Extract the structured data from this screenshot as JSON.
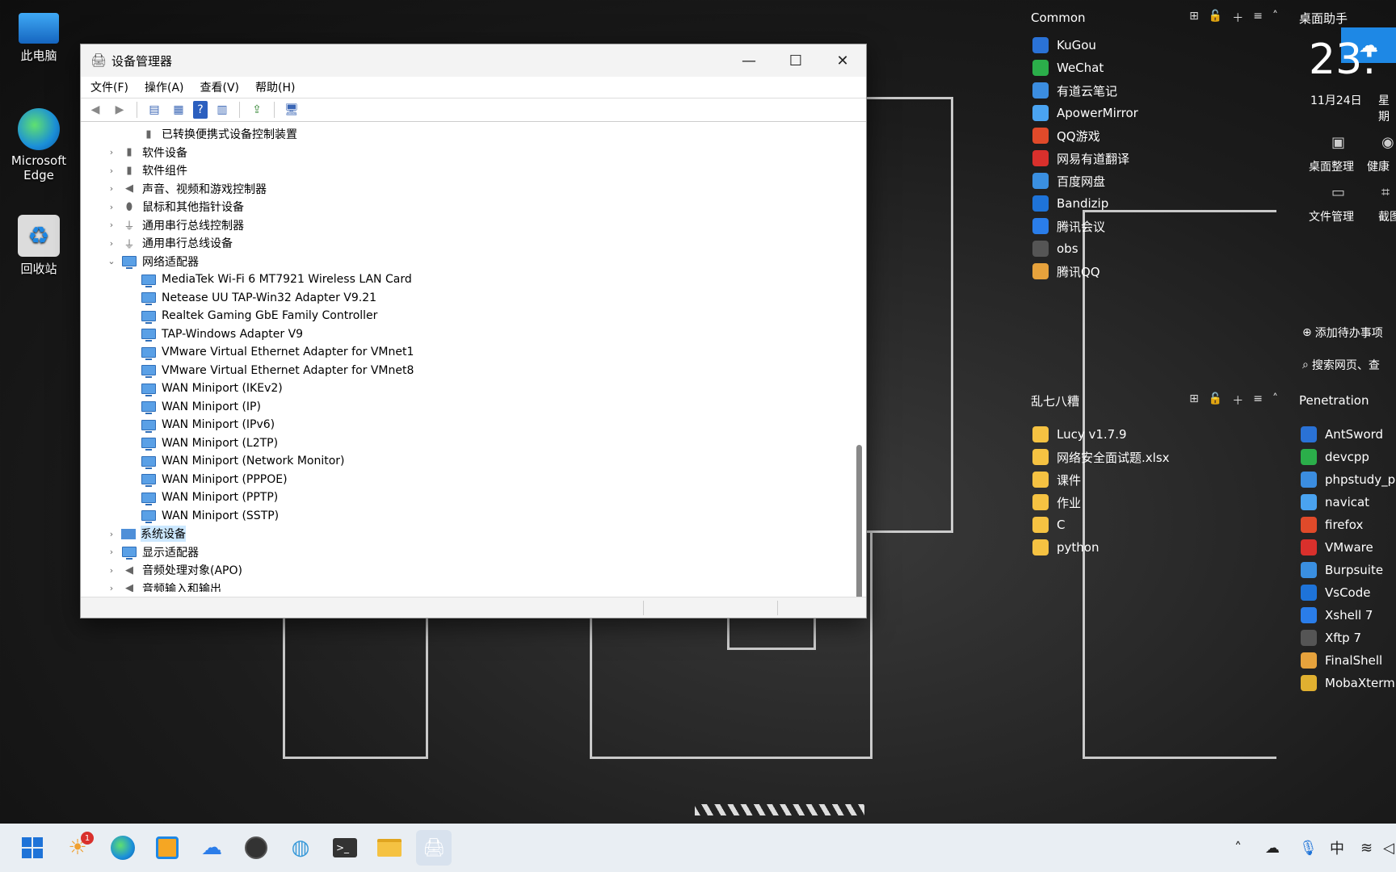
{
  "desktop": {
    "icons": [
      {
        "label": "此电脑"
      },
      {
        "label": "Microsoft Edge"
      },
      {
        "label": "回收站"
      }
    ]
  },
  "window": {
    "title": "设备管理器",
    "menu": [
      "文件(F)",
      "操作(A)",
      "查看(V)",
      "帮助(H)"
    ],
    "tree": [
      {
        "label": "已转换便携式设备控制装置",
        "level": 1,
        "expander": "",
        "icon": "device"
      },
      {
        "label": "软件设备",
        "level": 0,
        "expander": "›",
        "icon": "device"
      },
      {
        "label": "软件组件",
        "level": 0,
        "expander": "›",
        "icon": "device"
      },
      {
        "label": "声音、视频和游戏控制器",
        "level": 0,
        "expander": "›",
        "icon": "speaker"
      },
      {
        "label": "鼠标和其他指针设备",
        "level": 0,
        "expander": "›",
        "icon": "mouse"
      },
      {
        "label": "通用串行总线控制器",
        "level": 0,
        "expander": "›",
        "icon": "usb"
      },
      {
        "label": "通用串行总线设备",
        "level": 0,
        "expander": "›",
        "icon": "usb"
      },
      {
        "label": "网络适配器",
        "level": 0,
        "expander": "⌄",
        "icon": "net"
      },
      {
        "label": "MediaTek Wi-Fi 6 MT7921 Wireless LAN Card",
        "level": 1,
        "expander": "",
        "icon": "net"
      },
      {
        "label": "Netease UU TAP-Win32 Adapter V9.21",
        "level": 1,
        "expander": "",
        "icon": "net"
      },
      {
        "label": "Realtek Gaming GbE Family Controller",
        "level": 1,
        "expander": "",
        "icon": "net"
      },
      {
        "label": "TAP-Windows Adapter V9",
        "level": 1,
        "expander": "",
        "icon": "net"
      },
      {
        "label": "VMware Virtual Ethernet Adapter for VMnet1",
        "level": 1,
        "expander": "",
        "icon": "net"
      },
      {
        "label": "VMware Virtual Ethernet Adapter for VMnet8",
        "level": 1,
        "expander": "",
        "icon": "net"
      },
      {
        "label": "WAN Miniport (IKEv2)",
        "level": 1,
        "expander": "",
        "icon": "net"
      },
      {
        "label": "WAN Miniport (IP)",
        "level": 1,
        "expander": "",
        "icon": "net"
      },
      {
        "label": "WAN Miniport (IPv6)",
        "level": 1,
        "expander": "",
        "icon": "net"
      },
      {
        "label": "WAN Miniport (L2TP)",
        "level": 1,
        "expander": "",
        "icon": "net"
      },
      {
        "label": "WAN Miniport (Network Monitor)",
        "level": 1,
        "expander": "",
        "icon": "net"
      },
      {
        "label": "WAN Miniport (PPPOE)",
        "level": 1,
        "expander": "",
        "icon": "net"
      },
      {
        "label": "WAN Miniport (PPTP)",
        "level": 1,
        "expander": "",
        "icon": "net"
      },
      {
        "label": "WAN Miniport (SSTP)",
        "level": 1,
        "expander": "",
        "icon": "net"
      },
      {
        "label": "系统设备",
        "level": 0,
        "expander": "›",
        "icon": "folder",
        "selected": true
      },
      {
        "label": "显示适配器",
        "level": 0,
        "expander": "›",
        "icon": "monitor"
      },
      {
        "label": "音频处理对象(APO)",
        "level": 0,
        "expander": "›",
        "icon": "speaker"
      },
      {
        "label": "音频输入和输出",
        "level": 0,
        "expander": "›",
        "icon": "speaker"
      }
    ]
  },
  "fences": {
    "common": {
      "title": "Common",
      "items": [
        "KuGou",
        "WeChat",
        "有道云笔记",
        "ApowerMirror",
        "QQ游戏",
        "网易有道翻译",
        "百度网盘",
        "Bandizip",
        "腾讯会议",
        "obs",
        "腾讯QQ"
      ]
    },
    "misc": {
      "title": "乱七八糟",
      "items": [
        "Lucy v1.7.9",
        "网络安全面试题.xlsx",
        "课件",
        "作业",
        "C",
        "python"
      ]
    },
    "penetration": {
      "title": "Penetration",
      "items": [
        "AntSword",
        "devcpp",
        "phpstudy_p",
        "navicat",
        "firefox",
        "VMware",
        "Burpsuite",
        "VsCode",
        "Xshell 7",
        "Xftp 7",
        "FinalShell",
        "MobaXterm"
      ]
    }
  },
  "assistant": {
    "title": "桌面助手",
    "time": "23:",
    "date": "11月24日",
    "weekday": "星期",
    "tool1": "桌面整理",
    "tool2": "健康",
    "tool3": "文件管理",
    "tool4": "截图",
    "todo": "添加待办事项",
    "search": "搜索网页、查"
  },
  "taskbar": {
    "weather_badge": "1",
    "ime": "中"
  }
}
